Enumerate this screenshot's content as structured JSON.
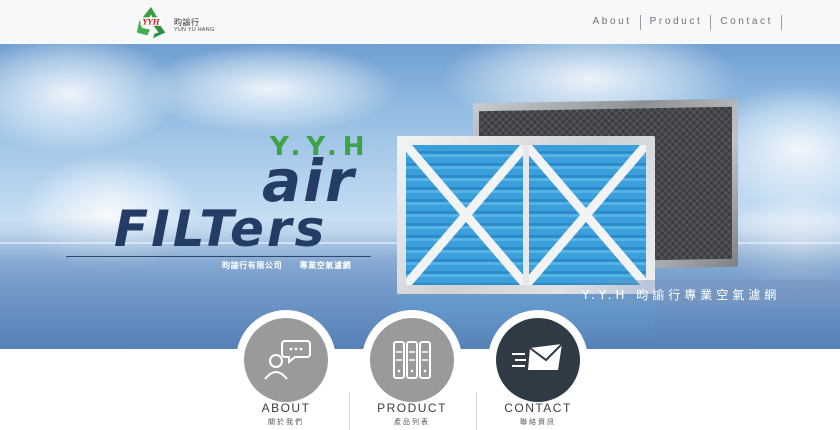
{
  "header": {
    "logo_mark_text": "YYH",
    "logo_cn": "昀諭行",
    "logo_en": "YUN YU HANG",
    "nav": [
      {
        "label": "About"
      },
      {
        "label": "Product"
      },
      {
        "label": "Contact"
      }
    ]
  },
  "hero": {
    "brand": "Y.Y.H",
    "title_line1": "air",
    "title_line2": "FILTers",
    "subtitle": "昀諭行有限公司 專業空氣濾網",
    "tagline": "Y.Y.H 昀諭行專業空氣濾網"
  },
  "sections": [
    {
      "label": "ABOUT",
      "sublabel": "關於我們",
      "icon": "person-chat-icon"
    },
    {
      "label": "PRODUCT",
      "sublabel": "產品列表",
      "icon": "filter-panels-icon"
    },
    {
      "label": "CONTACT",
      "sublabel": "聯絡資訊",
      "icon": "send-mail-icon"
    }
  ],
  "colors": {
    "brand_green": "#3ea346",
    "title_navy": "#253d66",
    "circle_gray": "#9a9a9a",
    "circle_dark": "#2f3a44"
  }
}
